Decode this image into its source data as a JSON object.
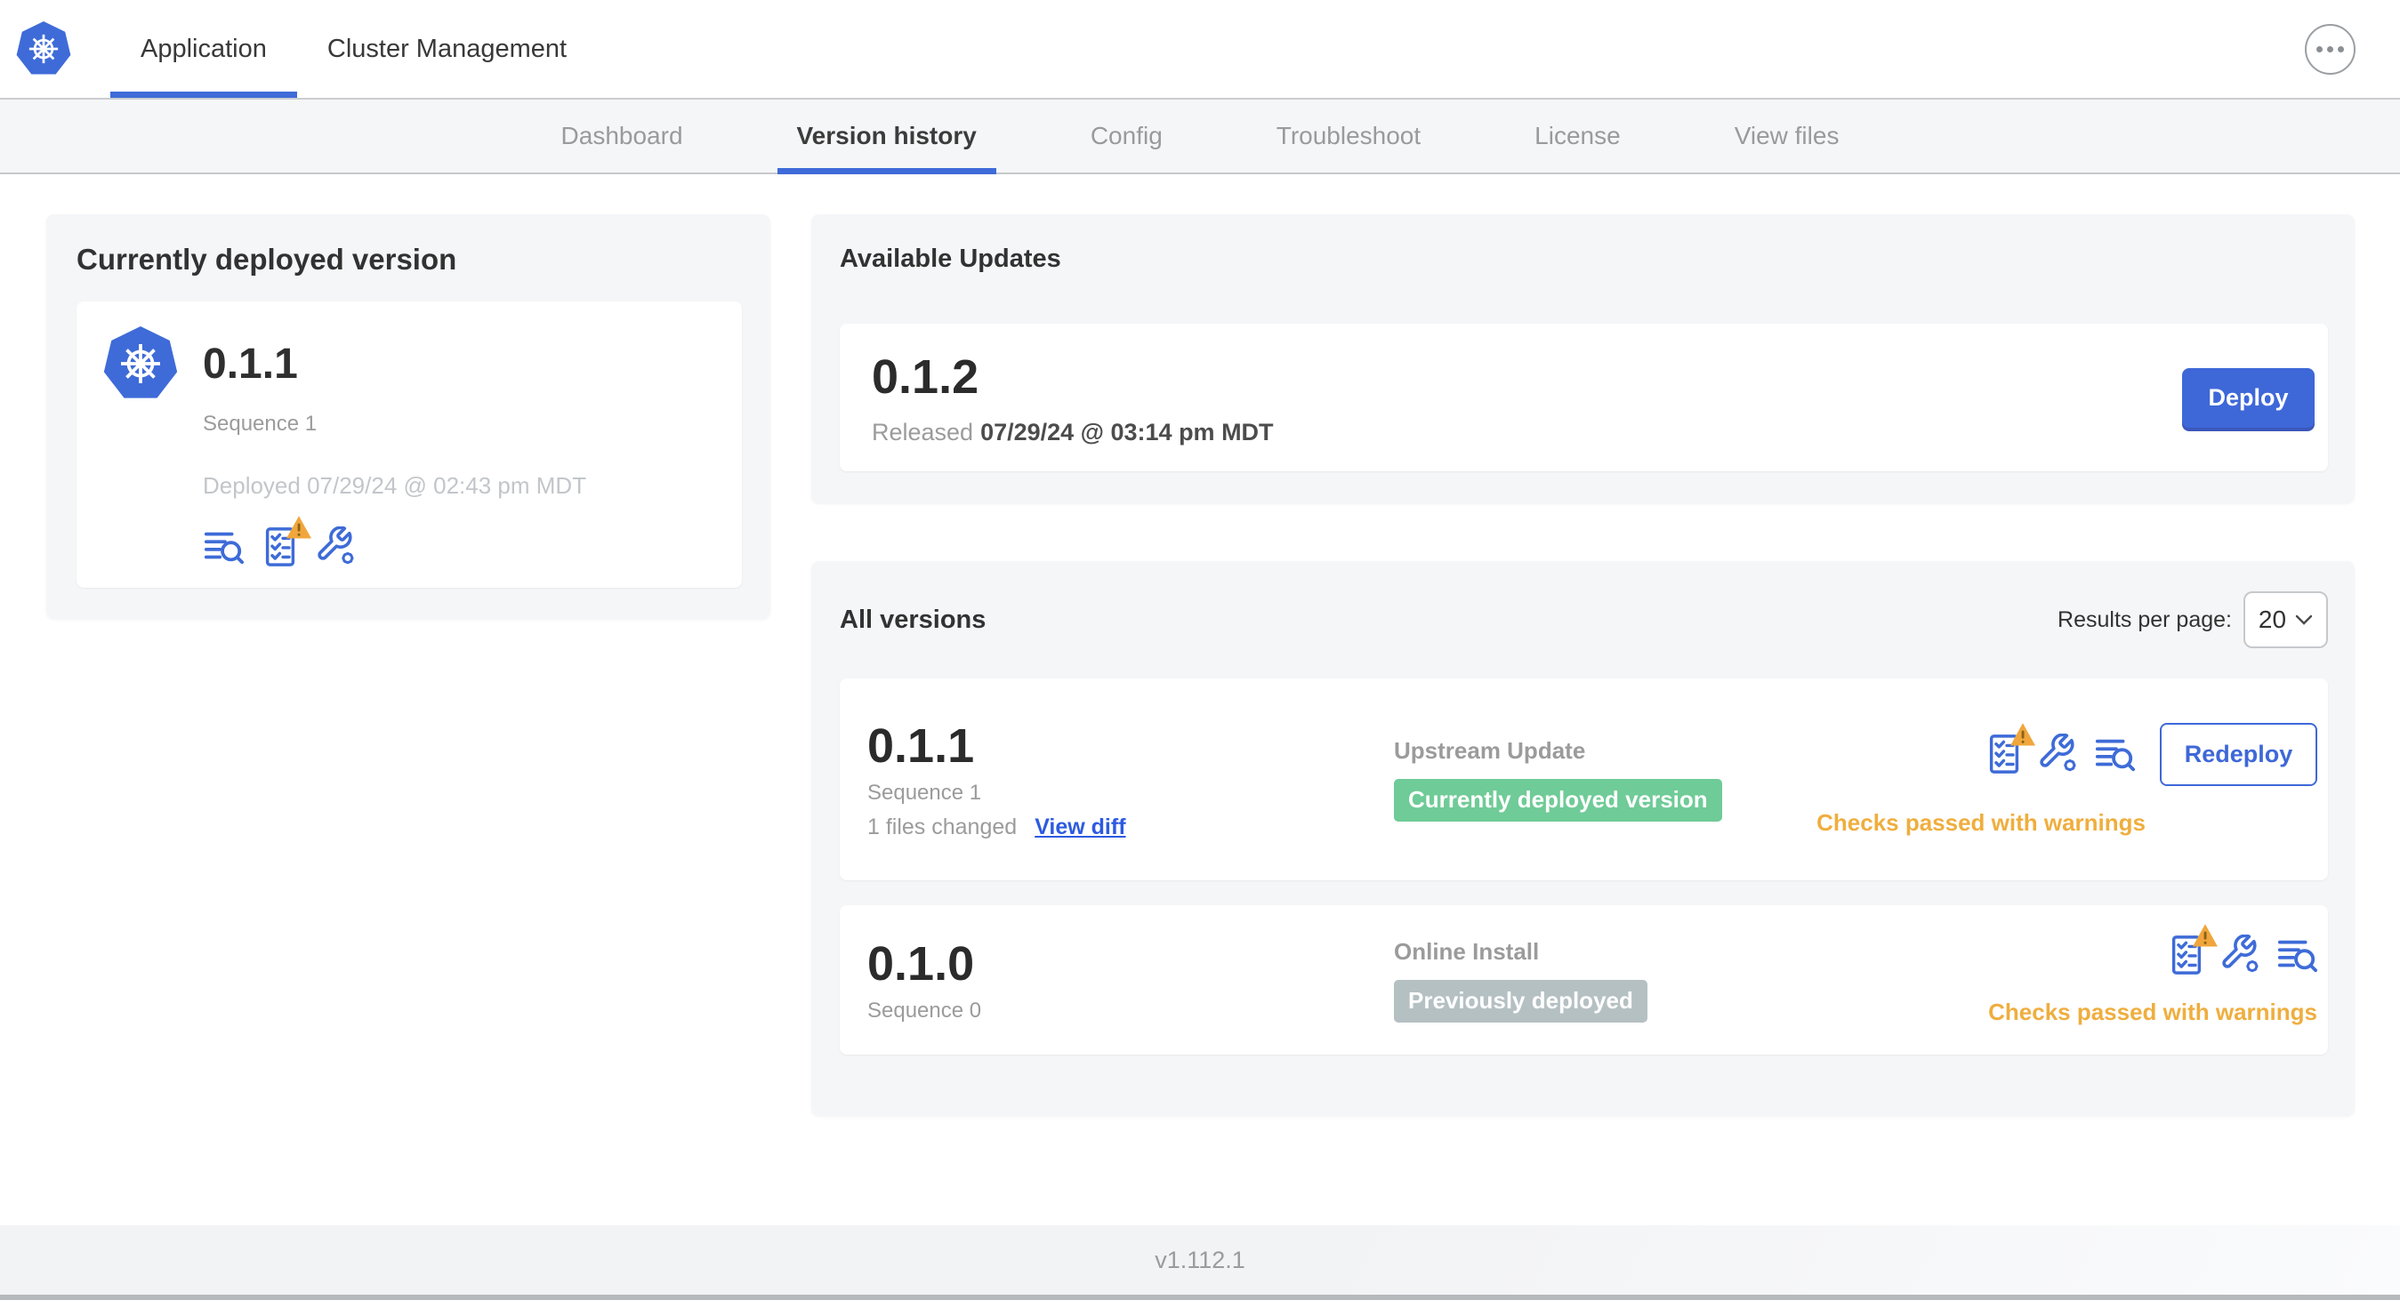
{
  "header": {
    "tabs": [
      {
        "label": "Application",
        "active": true
      },
      {
        "label": "Cluster Management",
        "active": false
      }
    ],
    "more_menu_icon": "ellipsis-icon"
  },
  "nav": {
    "items": [
      {
        "label": "Dashboard",
        "active": false
      },
      {
        "label": "Version history",
        "active": true
      },
      {
        "label": "Config",
        "active": false
      },
      {
        "label": "Troubleshoot",
        "active": false
      },
      {
        "label": "License",
        "active": false
      },
      {
        "label": "View files",
        "active": false
      }
    ]
  },
  "current_version": {
    "title": "Currently deployed version",
    "version": "0.1.1",
    "sequence": "Sequence 1",
    "deployed": "Deployed 07/29/24 @ 02:43 pm MDT",
    "icons": [
      "diff-logs-icon",
      "preflight-checks-warning-icon",
      "wrench-config-icon"
    ]
  },
  "available_updates": {
    "title": "Available Updates",
    "version": "0.1.2",
    "released_label": "Released",
    "released_date": "07/29/24 @ 03:14 pm MDT",
    "deploy_label": "Deploy"
  },
  "all_versions": {
    "title": "All versions",
    "results_per_page_label": "Results per page:",
    "results_per_page_value": "20",
    "rows": [
      {
        "version": "0.1.1",
        "sequence": "Sequence 1",
        "files_changed": "1 files changed",
        "view_diff_label": "View diff",
        "source": "Upstream Update",
        "badge": "Currently deployed version",
        "badge_type": "green",
        "status": "Checks passed with warnings",
        "action_label": "Redeploy",
        "icons": [
          "preflight-checks-warning-icon",
          "wrench-config-icon",
          "diff-logs-icon"
        ]
      },
      {
        "version": "0.1.0",
        "sequence": "Sequence 0",
        "source": "Online Install",
        "badge": "Previously deployed",
        "badge_type": "gray",
        "status": "Checks passed with warnings",
        "icons": [
          "preflight-checks-warning-icon",
          "wrench-config-icon",
          "diff-logs-icon"
        ]
      }
    ]
  },
  "footer": {
    "version": "v1.112.1"
  },
  "colors": {
    "primary_blue": "#3e68d8",
    "link_blue": "#2d5be0",
    "badge_green": "#6fcb97",
    "badge_gray": "#b5c0c3",
    "warning_amber": "#efae3e",
    "panel_gray": "#f5f6f8",
    "text_dark": "#323232",
    "text_gray": "#9b9b9b"
  }
}
